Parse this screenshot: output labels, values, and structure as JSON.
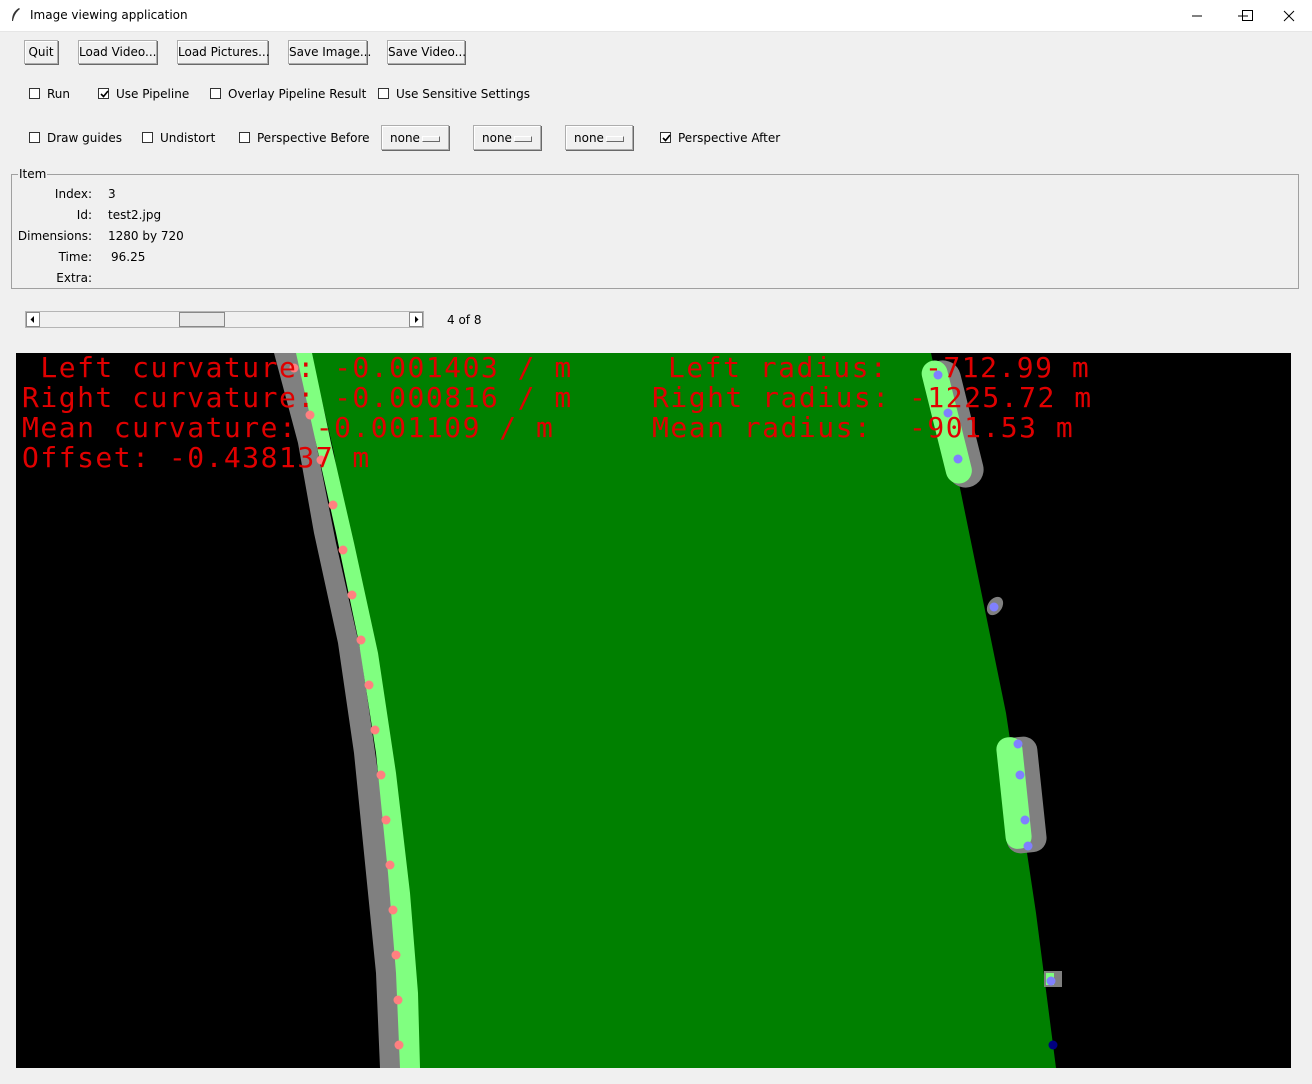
{
  "window": {
    "title": "Image viewing application"
  },
  "toolbar": {
    "quit": "Quit",
    "load_video": "Load Video...",
    "load_pictures": "Load Pictures...",
    "save_image": "Save Image...",
    "save_video": "Save Video..."
  },
  "options_row1": [
    {
      "label": "Run",
      "checked": false
    },
    {
      "label": "Use Pipeline",
      "checked": true
    },
    {
      "label": "Overlay Pipeline Result",
      "checked": false
    },
    {
      "label": "Use Sensitive Settings",
      "checked": false
    }
  ],
  "options_row2": {
    "draw_guides": {
      "label": "Draw guides",
      "checked": false
    },
    "undistort": {
      "label": "Undistort",
      "checked": false
    },
    "perspective_before": {
      "label": "Perspective Before",
      "checked": false
    },
    "menus": [
      "none",
      "none",
      "none"
    ],
    "perspective_after": {
      "label": "Perspective After",
      "checked": true
    }
  },
  "item": {
    "frame_label": "Item",
    "index_label": "Index:",
    "index_value": "3",
    "id_label": "Id:",
    "id_value": "test2.jpg",
    "dimensions_label": "Dimensions:",
    "dimensions_value": "1280 by 720",
    "time_label": "Time:",
    "time_value": "96.25",
    "extra_label": "Extra:",
    "extra_value": ""
  },
  "navigator": {
    "position_text": "4 of 8",
    "current": 4,
    "total": 8
  },
  "overlay": {
    "left_curvature": " Left curvature: -0.001403 / m",
    "right_curvature": "Right curvature: -0.000816 / m",
    "mean_curvature": "Mean curvature: -0.001109 / m",
    "offset": "Offset: -0.438137 m",
    "left_radius": "Left radius:  -712.99 m",
    "right_radius": "Right radius: -1225.72 m",
    "mean_radius": "Mean radius:  -901.53 m"
  },
  "colors": {
    "lane_fill": "#008000",
    "lane_line_band": "#80ff80",
    "line_gray": "#808080",
    "left_points": "#ff8080",
    "right_points": "#8080ff",
    "overlay_text": "#e00000"
  }
}
